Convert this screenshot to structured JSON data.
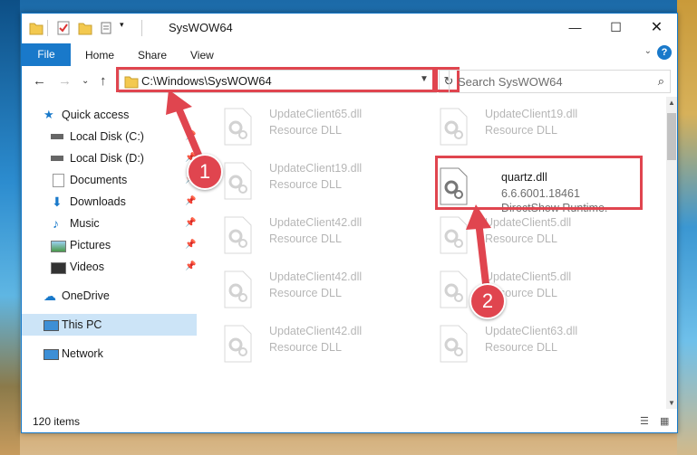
{
  "window": {
    "title": "SysWOW64"
  },
  "ribbon": {
    "file": "File",
    "home": "Home",
    "share": "Share",
    "view": "View",
    "help": "?"
  },
  "address": {
    "path": "C:\\Windows\\SysWOW64",
    "search_placeholder": "Search SysWOW64"
  },
  "sidebar": {
    "items": [
      {
        "label": "Quick access"
      },
      {
        "label": "Local Disk (C:)"
      },
      {
        "label": "Local Disk (D:)"
      },
      {
        "label": "Documents"
      },
      {
        "label": "Downloads"
      },
      {
        "label": "Music"
      },
      {
        "label": "Pictures"
      },
      {
        "label": "Videos"
      },
      {
        "label": "OneDrive"
      },
      {
        "label": "This PC"
      },
      {
        "label": "Network"
      }
    ]
  },
  "files": {
    "left": [
      {
        "name": "UpdateClient65.dll",
        "type": "Resource DLL"
      },
      {
        "name": "UpdateClient19.dll",
        "type": "Resource DLL"
      },
      {
        "name": "UpdateClient42.dll",
        "type": "Resource DLL"
      },
      {
        "name": "UpdateClient42.dll",
        "type": "Resource DLL"
      },
      {
        "name": "UpdateClient42.dll",
        "type": "Resource DLL"
      }
    ],
    "right": [
      {
        "name": "UpdateClient19.dll",
        "type": "Resource DLL"
      },
      {
        "name": "UpdateClient5.dll",
        "type": "Resource DLL"
      },
      {
        "name": "UpdateClient5.dll",
        "type": "Resource DLL"
      },
      {
        "name": "UpdateClient63.dll",
        "type": "Resource DLL"
      }
    ],
    "highlighted": {
      "name": "quartz.dll",
      "version": "6.6.6001.18461",
      "description": "DirectShow Runtime."
    }
  },
  "status": {
    "items": "120 items"
  },
  "annotations": {
    "step1": "1",
    "step2": "2",
    "color": "#e0454f"
  }
}
